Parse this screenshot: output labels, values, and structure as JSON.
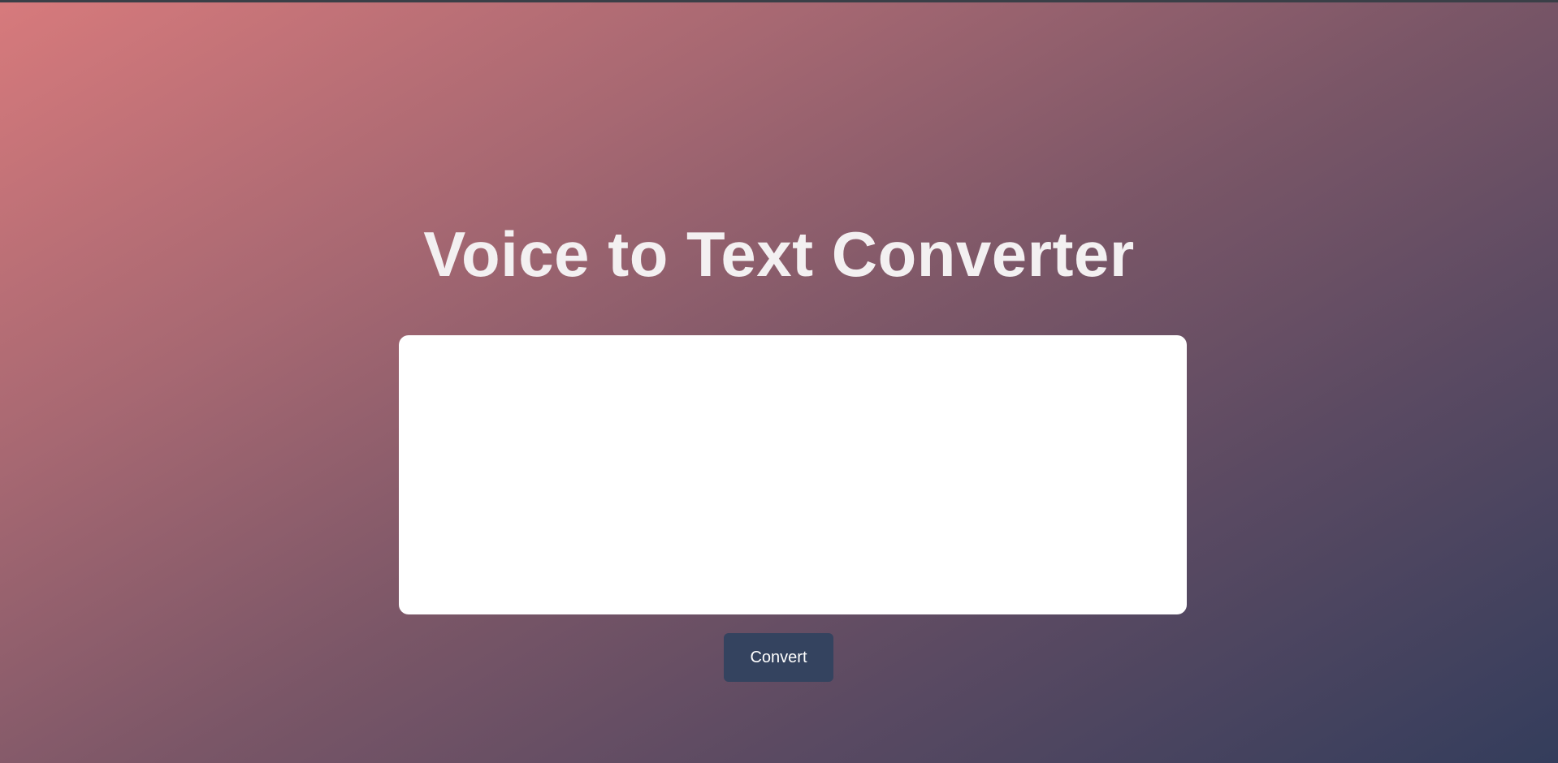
{
  "page": {
    "title": "Voice to Text Converter"
  },
  "transcript": {
    "value": "",
    "placeholder": ""
  },
  "actions": {
    "convert_label": "Convert"
  },
  "colors": {
    "gradient_start": "#d77a7c",
    "gradient_end": "#343d5c",
    "title_text": "#f3f0f1",
    "button_background": "#34435f",
    "button_text": "#ffffff",
    "textarea_background": "#ffffff"
  }
}
